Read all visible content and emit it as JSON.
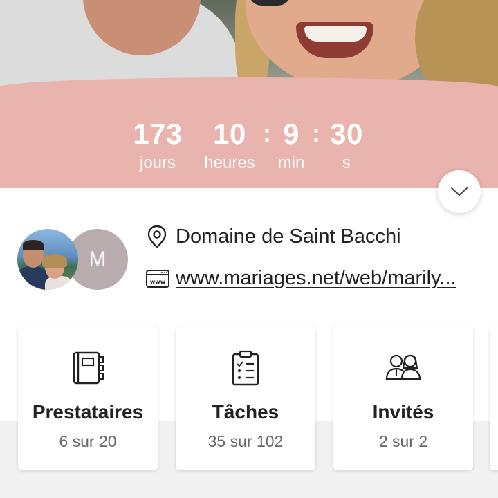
{
  "countdown": {
    "days": {
      "value": "173",
      "label": "jours"
    },
    "hours": {
      "value": "10",
      "label": "heures"
    },
    "minutes": {
      "value": "9",
      "label": "min"
    },
    "seconds": {
      "value": "30",
      "label": "s"
    },
    "separator": ":"
  },
  "avatar": {
    "initial": "M"
  },
  "venue": {
    "name": "Domaine de Saint Bacchi",
    "icon": "location-pin-icon"
  },
  "website": {
    "url": "www.mariages.net/web/marily...",
    "icon": "www-icon",
    "icon_text": "www"
  },
  "cards": [
    {
      "title": "Prestataires",
      "progress": "6 sur 20",
      "icon": "vendors-book-icon"
    },
    {
      "title": "Tâches",
      "progress": "35 sur 102",
      "icon": "checklist-icon"
    },
    {
      "title": "Invités",
      "progress": "2 sur 2",
      "icon": "guests-icon"
    }
  ],
  "colors": {
    "band": "#e8b4ad",
    "avatar_bg": "#b8acae",
    "text": "#222222",
    "subtext": "#666666"
  }
}
